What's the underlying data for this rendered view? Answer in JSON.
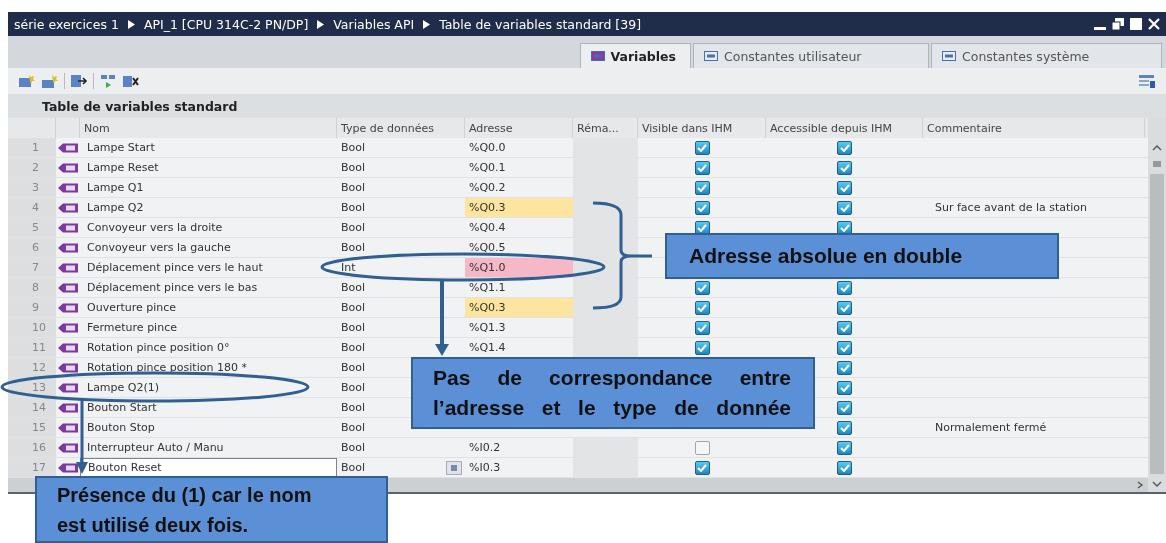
{
  "breadcrumb": [
    "série exercices 1",
    "API_1 [CPU 314C-2 PN/DP]",
    "Variables API",
    "Table de variables standard [39]"
  ],
  "tabs": [
    {
      "label": "Variables",
      "selected": true
    },
    {
      "label": "Constantes utilisateur",
      "selected": false
    },
    {
      "label": "Constantes système",
      "selected": false
    }
  ],
  "table": {
    "title": "Table de variables standard",
    "columns": [
      "Nom",
      "Type de données",
      "Adresse",
      "Réma...",
      "Visible dans IHM",
      "Accessible depuis IHM",
      "Commentaire"
    ],
    "rows": [
      {
        "num": "1",
        "name": "Lampe Start",
        "type": "Bool",
        "address": "%Q0.0",
        "duplicate": false,
        "type_mismatch": false,
        "visible": true,
        "accessible": true,
        "editing": false
      },
      {
        "num": "2",
        "name": "Lampe Reset",
        "type": "Bool",
        "address": "%Q0.1",
        "duplicate": false,
        "type_mismatch": false,
        "visible": true,
        "accessible": true,
        "editing": false
      },
      {
        "num": "3",
        "name": "Lampe Q1",
        "type": "Bool",
        "address": "%Q0.2",
        "duplicate": false,
        "type_mismatch": false,
        "visible": true,
        "accessible": true,
        "editing": false
      },
      {
        "num": "4",
        "name": "Lampe Q2",
        "type": "Bool",
        "address": "%Q0.3",
        "duplicate": true,
        "type_mismatch": false,
        "visible": true,
        "accessible": true,
        "comment": "Sur face avant de la station",
        "editing": false
      },
      {
        "num": "5",
        "name": "Convoyeur vers la droite",
        "type": "Bool",
        "address": "%Q0.4",
        "duplicate": false,
        "type_mismatch": false,
        "visible": true,
        "accessible": true,
        "editing": false
      },
      {
        "num": "6",
        "name": "Convoyeur vers la gauche",
        "type": "Bool",
        "address": "%Q0.5",
        "duplicate": false,
        "type_mismatch": false,
        "editing": false
      },
      {
        "num": "7",
        "name": "Déplacement pince vers le haut",
        "type": "Int",
        "address": "%Q1.0",
        "duplicate": false,
        "type_mismatch": true,
        "editing": false
      },
      {
        "num": "8",
        "name": "Déplacement pince vers le bas",
        "type": "Bool",
        "address": "%Q1.1",
        "duplicate": false,
        "type_mismatch": false,
        "visible": true,
        "accessible": true,
        "editing": false
      },
      {
        "num": "9",
        "name": "Ouverture pince",
        "type": "Bool",
        "address": "%Q0.3",
        "duplicate": true,
        "type_mismatch": false,
        "visible": true,
        "accessible": true,
        "editing": false
      },
      {
        "num": "10",
        "name": "Fermeture pince",
        "type": "Bool",
        "address": "%Q1.3",
        "duplicate": false,
        "type_mismatch": false,
        "visible": true,
        "accessible": true,
        "editing": false
      },
      {
        "num": "11",
        "name": "Rotation pince position 0°",
        "type": "Bool",
        "address": "%Q1.4",
        "duplicate": false,
        "type_mismatch": false,
        "visible": true,
        "accessible": true,
        "editing": false
      },
      {
        "num": "12",
        "name": "Rotation pince position 180 *",
        "type": "Bool",
        "duplicate": false,
        "type_mismatch": false,
        "accessible": true,
        "editing": false
      },
      {
        "num": "13",
        "name": "Lampe Q2(1)",
        "type": "Bool",
        "duplicate": false,
        "type_mismatch": false,
        "accessible": true,
        "editing": false
      },
      {
        "num": "14",
        "name": "Bouton Start",
        "type": "Bool",
        "duplicate": false,
        "type_mismatch": false,
        "accessible": true,
        "editing": false
      },
      {
        "num": "15",
        "name": "Bouton Stop",
        "type": "Bool",
        "duplicate": false,
        "type_mismatch": false,
        "accessible": true,
        "comment": "Normalement fermé",
        "editing": false
      },
      {
        "num": "16",
        "name": "Interrupteur Auto / Manu",
        "type": "Bool",
        "address": "%I0.2",
        "duplicate": false,
        "type_mismatch": false,
        "visible": false,
        "accessible": true,
        "editing": false
      },
      {
        "num": "17",
        "name": "Bouton Reset",
        "type": "Bool",
        "address": "%I0.3",
        "duplicate": false,
        "type_mismatch": false,
        "visible": true,
        "accessible": true,
        "editing": true
      }
    ]
  },
  "callouts": [
    {
      "kind": "duplicate",
      "text": "Adresse absolue en double"
    },
    {
      "kind": "mismatch",
      "lines": [
        "Pas de correspondance  entre",
        "l’adresse et le type de donnée"
      ]
    },
    {
      "kind": "name",
      "lines": [
        "Présence du (1) car le nom",
        "est utilisé deux fois."
      ]
    }
  ]
}
